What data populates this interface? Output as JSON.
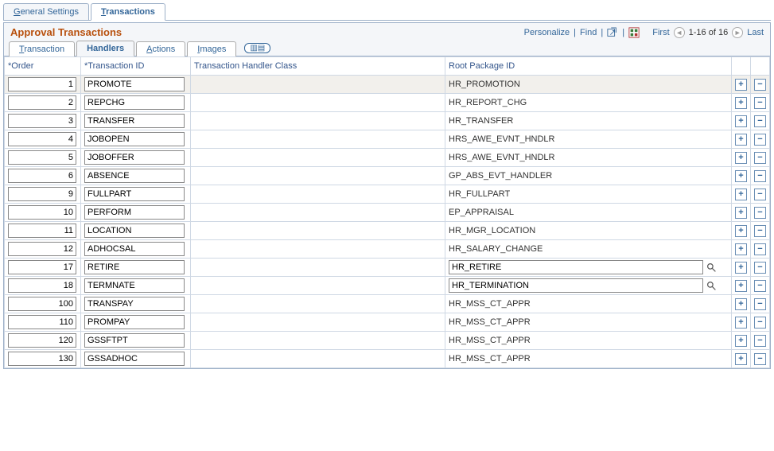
{
  "page_tabs": {
    "general": "General Settings",
    "transactions": "Transactions"
  },
  "panel": {
    "title": "Approval Transactions",
    "personalize": "Personalize",
    "find": "Find",
    "first": "First",
    "count": "1-16 of 16",
    "last": "Last"
  },
  "sub_tabs": {
    "transaction": "Transaction",
    "handlers": "Handlers",
    "actions": "Actions",
    "images": "Images"
  },
  "columns": {
    "order": "*Order",
    "txnid": "*Transaction ID",
    "handler": "Transaction Handler Class",
    "rootpkg": "Root Package ID"
  },
  "rows": [
    {
      "order": "1",
      "txnid": "PROMOTE",
      "handler": "",
      "rootpkg": "HR_PROMOTION",
      "editable": false,
      "highlight": true
    },
    {
      "order": "2",
      "txnid": "REPCHG",
      "handler": "",
      "rootpkg": "HR_REPORT_CHG",
      "editable": false
    },
    {
      "order": "3",
      "txnid": "TRANSFER",
      "handler": "",
      "rootpkg": "HR_TRANSFER",
      "editable": false
    },
    {
      "order": "4",
      "txnid": "JOBOPEN",
      "handler": "",
      "rootpkg": "HRS_AWE_EVNT_HNDLR",
      "editable": false
    },
    {
      "order": "5",
      "txnid": "JOBOFFER",
      "handler": "",
      "rootpkg": "HRS_AWE_EVNT_HNDLR",
      "editable": false
    },
    {
      "order": "6",
      "txnid": "ABSENCE",
      "handler": "",
      "rootpkg": "GP_ABS_EVT_HANDLER",
      "editable": false
    },
    {
      "order": "9",
      "txnid": "FULLPART",
      "handler": "",
      "rootpkg": "HR_FULLPART",
      "editable": false
    },
    {
      "order": "10",
      "txnid": "PERFORM",
      "handler": "",
      "rootpkg": "EP_APPRAISAL",
      "editable": false
    },
    {
      "order": "11",
      "txnid": "LOCATION",
      "handler": "",
      "rootpkg": "HR_MGR_LOCATION",
      "editable": false
    },
    {
      "order": "12",
      "txnid": "ADHOCSAL",
      "handler": "",
      "rootpkg": "HR_SALARY_CHANGE",
      "editable": false
    },
    {
      "order": "17",
      "txnid": "RETIRE",
      "handler": "",
      "rootpkg": "HR_RETIRE",
      "editable": true
    },
    {
      "order": "18",
      "txnid": "TERMNATE",
      "handler": "",
      "rootpkg": "HR_TERMINATION",
      "editable": true
    },
    {
      "order": "100",
      "txnid": "TRANSPAY",
      "handler": "",
      "rootpkg": "HR_MSS_CT_APPR",
      "editable": false
    },
    {
      "order": "110",
      "txnid": "PROMPAY",
      "handler": "",
      "rootpkg": "HR_MSS_CT_APPR",
      "editable": false
    },
    {
      "order": "120",
      "txnid": "GSSFTPT",
      "handler": "",
      "rootpkg": "HR_MSS_CT_APPR",
      "editable": false
    },
    {
      "order": "130",
      "txnid": "GSSADHOC",
      "handler": "",
      "rootpkg": "HR_MSS_CT_APPR",
      "editable": false
    }
  ]
}
